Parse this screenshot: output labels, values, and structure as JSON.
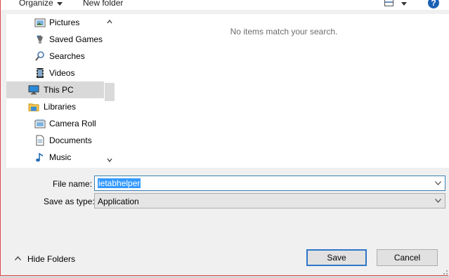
{
  "toolbar": {
    "organize_label": "Organize",
    "new_folder_label": "New folder",
    "help_glyph": "?"
  },
  "nav": {
    "items": [
      {
        "label": "Pictures",
        "icon": "pictures-icon"
      },
      {
        "label": "Saved Games",
        "icon": "saved-games-icon"
      },
      {
        "label": "Searches",
        "icon": "searches-icon"
      },
      {
        "label": "Videos",
        "icon": "videos-icon"
      },
      {
        "label": "This PC",
        "icon": "this-pc-icon",
        "selected": true
      },
      {
        "label": "Libraries",
        "icon": "libraries-icon"
      },
      {
        "label": "Camera Roll",
        "icon": "camera-roll-icon"
      },
      {
        "label": "Documents",
        "icon": "documents-icon"
      },
      {
        "label": "Music",
        "icon": "music-icon"
      }
    ]
  },
  "content": {
    "empty_message": "No items match your search."
  },
  "form": {
    "file_name_label": "File name:",
    "file_name_value": "ietabhelper",
    "save_type_label": "Save as type:",
    "save_type_value": "Application"
  },
  "footer": {
    "hide_folders_label": "Hide Folders",
    "save_label": "Save",
    "cancel_label": "Cancel"
  },
  "colors": {
    "accent": "#2f76c9",
    "selection": "#3399ff",
    "selected_nav": "#d9d9d9",
    "window_border": "#e04848"
  }
}
